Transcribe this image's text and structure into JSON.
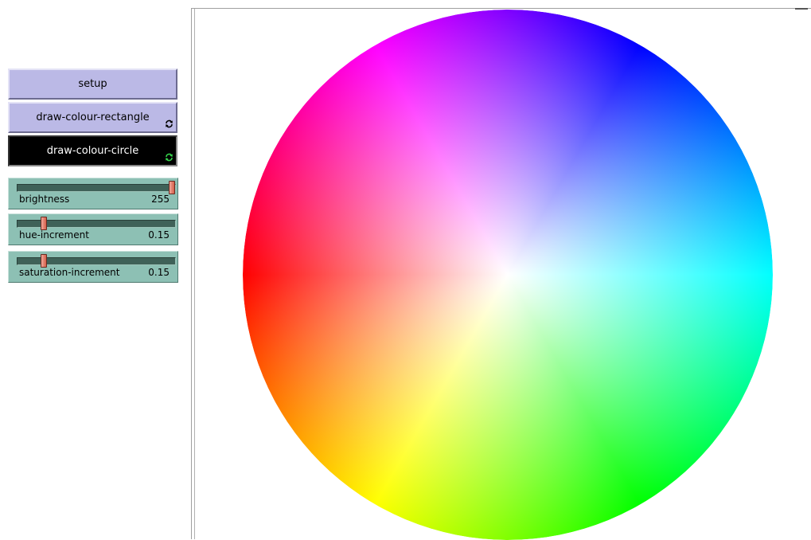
{
  "buttons": {
    "setup_label": "setup",
    "draw_colour_rectangle_label": "draw-colour-rectangle",
    "draw_colour_circle_label": "draw-colour-circle"
  },
  "sliders": {
    "brightness": {
      "label": "brightness",
      "value": "255",
      "fraction": 1.0
    },
    "hue_increment": {
      "label": "hue-increment",
      "value": "0.15",
      "fraction": 0.15
    },
    "saturation_increment": {
      "label": "saturation-increment",
      "value": "0.15",
      "fraction": 0.15
    }
  },
  "view": {
    "hue_stops": [
      "#ff0000",
      "#ffff00",
      "#00ff00",
      "#00ffff",
      "#0000ff",
      "#ff00ff",
      "#ff0000"
    ],
    "center_color": "#ffffff"
  },
  "colors": {
    "button_bg": "#bbb9e6",
    "button_pressed_bg": "#000000",
    "slider_bg": "#8dc0b4",
    "forever_icon_dark": "#000000",
    "forever_icon_active": "#35d24a"
  }
}
